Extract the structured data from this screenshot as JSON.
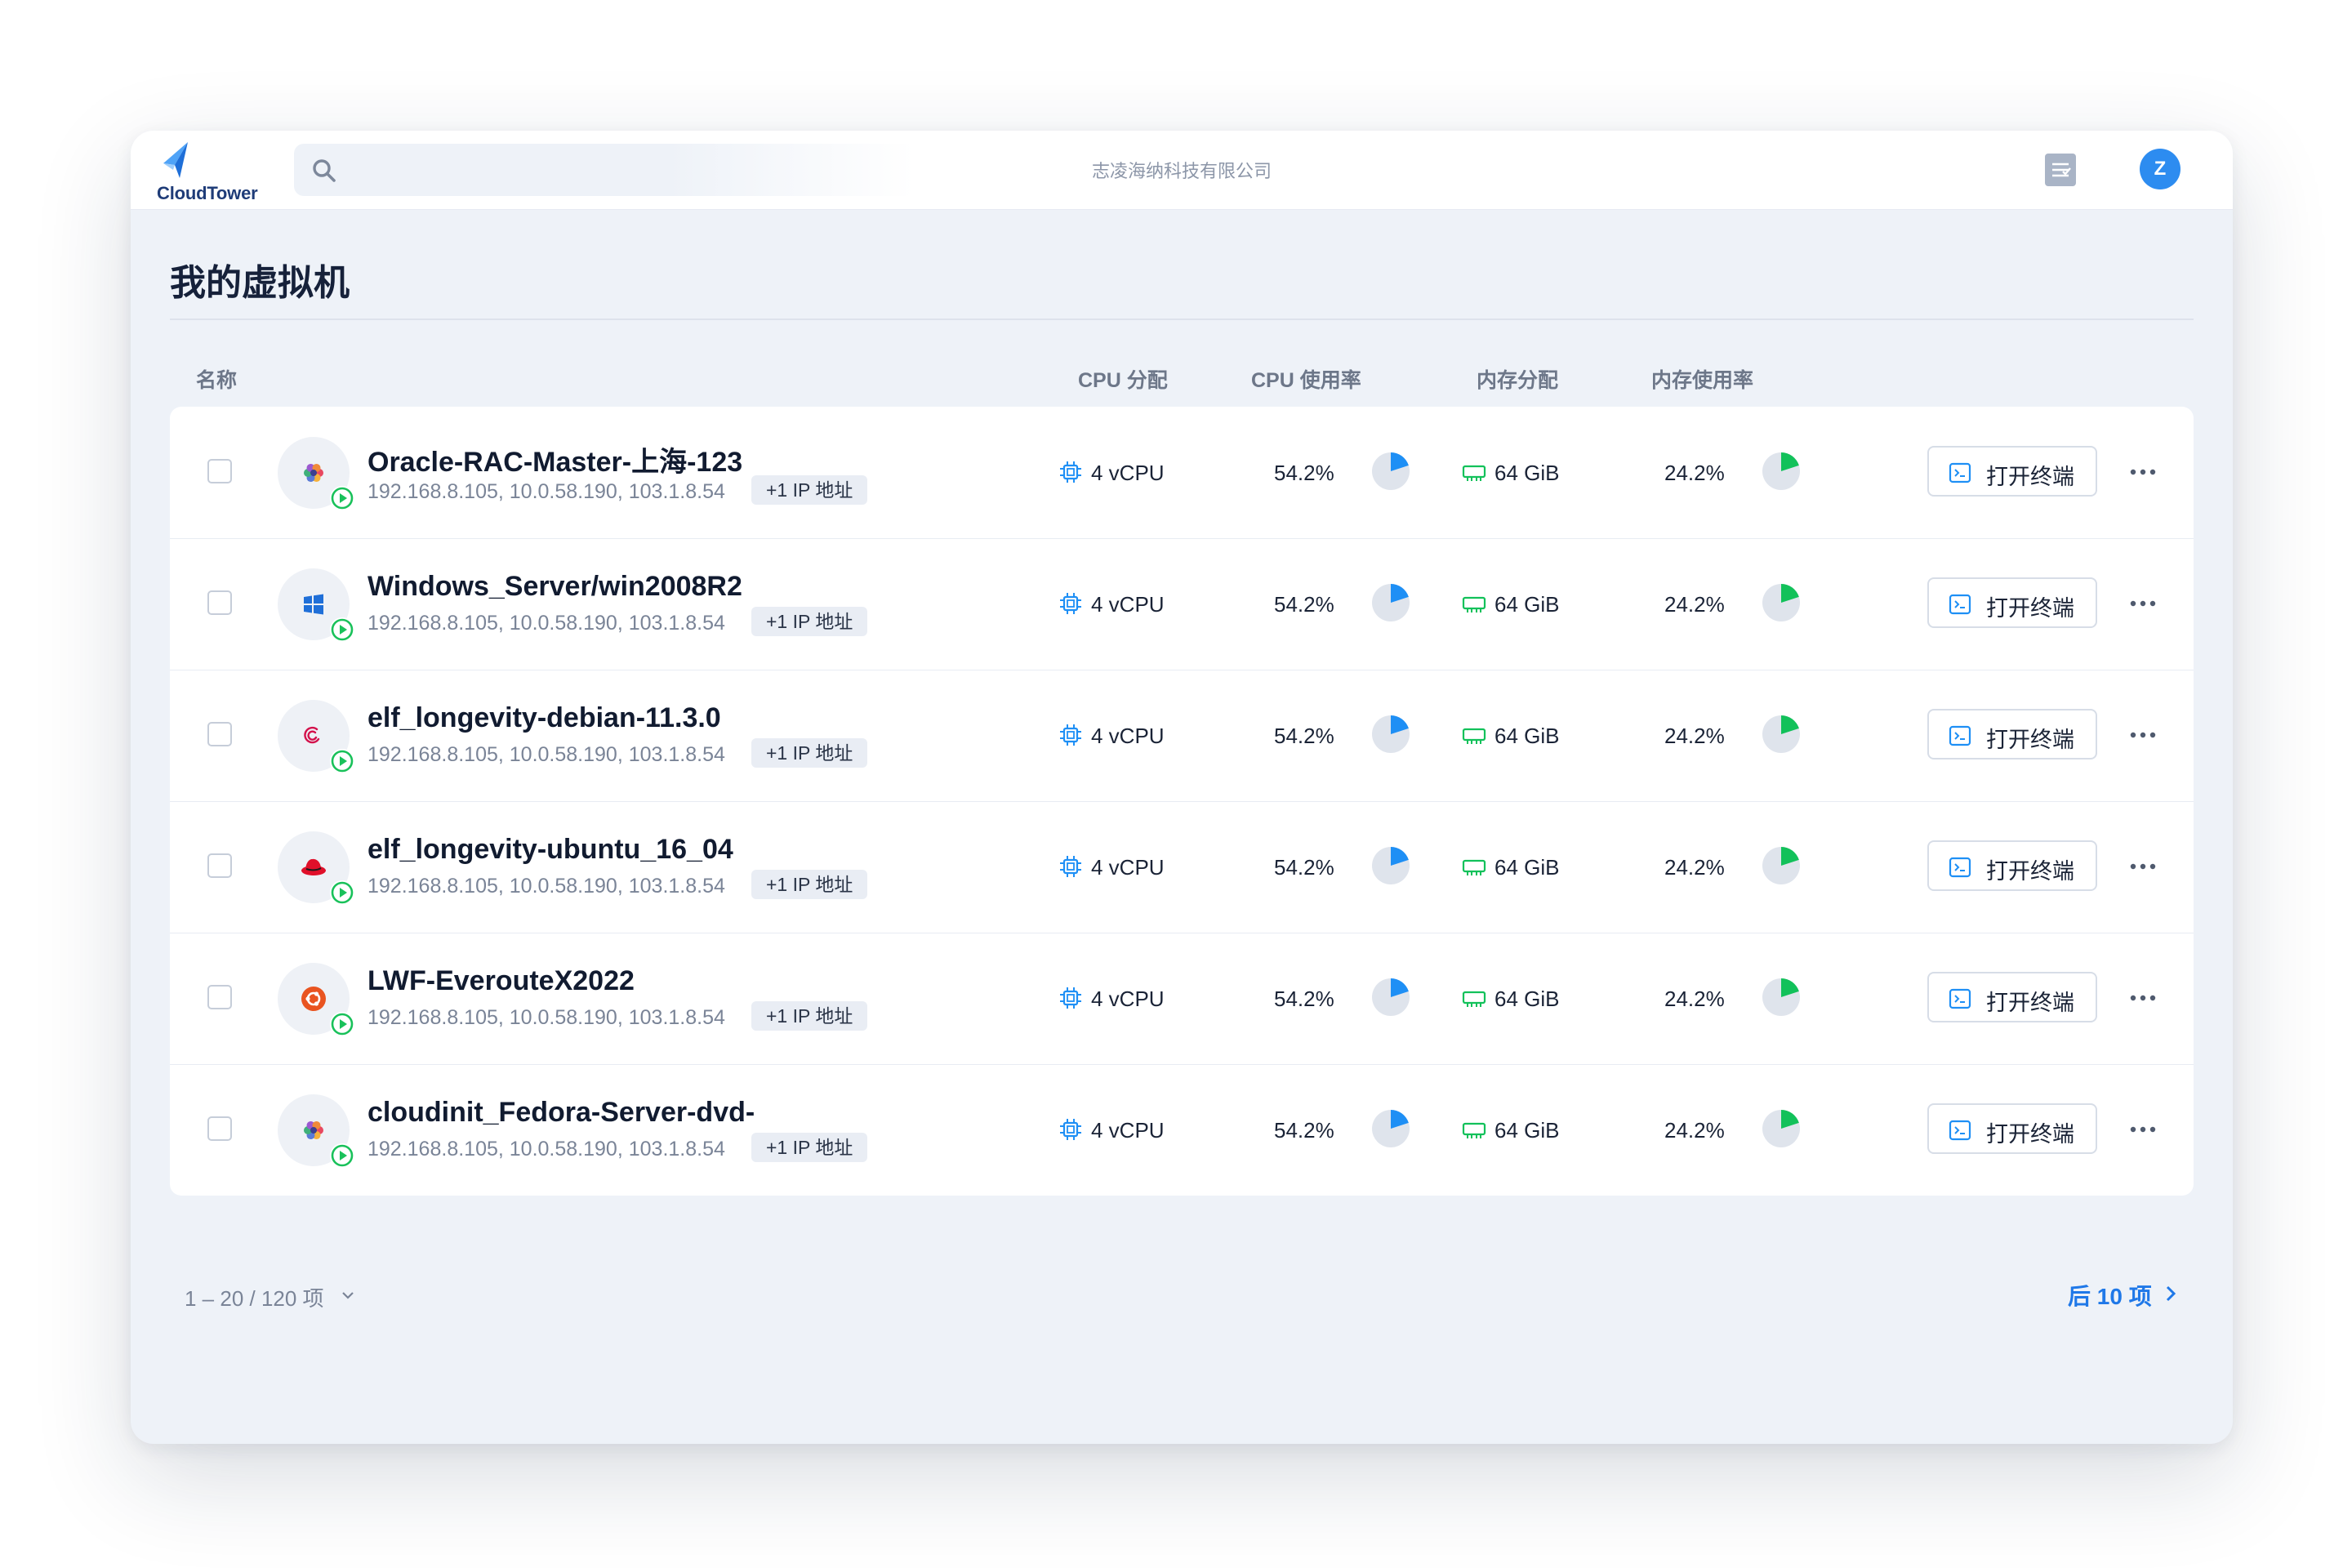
{
  "header": {
    "logo_text": "CloudTower",
    "company": "志凌海纳科技有限公司",
    "avatar_letter": "Z"
  },
  "page": {
    "title": "我的虚拟机"
  },
  "columns": {
    "name": "名称",
    "cpu_alloc": "CPU 分配",
    "cpu_usage": "CPU 使用率",
    "mem_alloc": "内存分配",
    "mem_usage": "内存使用率"
  },
  "colors": {
    "accent": "#1f78e8",
    "cpu_pie": "#1e8ff5",
    "mem_pie": "#12c15a",
    "pie_track": "#dfe4ec",
    "running": "#19c15a"
  },
  "vms": [
    {
      "name": "Oracle-RAC-Master-上海-123",
      "os_icon": "fedora-icon",
      "status": "running",
      "ips": "192.168.8.105, 10.0.58.190, 103.1.8.54",
      "extra_ips": "+1 IP 地址",
      "cpu_alloc": "4 vCPU",
      "cpu_usage": "54.2%",
      "cpu_fraction": 0.2,
      "mem_alloc": "64 GiB",
      "mem_usage": "24.2%",
      "mem_fraction": 0.2,
      "terminal_label": "打开终端"
    },
    {
      "name": "Windows_Server/win2008R2",
      "os_icon": "windows-icon",
      "status": "running",
      "ips": "192.168.8.105, 10.0.58.190, 103.1.8.54",
      "extra_ips": "+1 IP 地址",
      "cpu_alloc": "4 vCPU",
      "cpu_usage": "54.2%",
      "cpu_fraction": 0.2,
      "mem_alloc": "64 GiB",
      "mem_usage": "24.2%",
      "mem_fraction": 0.2,
      "terminal_label": "打开终端"
    },
    {
      "name": "elf_longevity-debian-11.3.0",
      "os_icon": "debian-icon",
      "status": "running",
      "ips": "192.168.8.105, 10.0.58.190, 103.1.8.54",
      "extra_ips": "+1 IP 地址",
      "cpu_alloc": "4 vCPU",
      "cpu_usage": "54.2%",
      "cpu_fraction": 0.2,
      "mem_alloc": "64 GiB",
      "mem_usage": "24.2%",
      "mem_fraction": 0.2,
      "terminal_label": "打开终端"
    },
    {
      "name": "elf_longevity-ubuntu_16_04",
      "os_icon": "redhat-icon",
      "status": "running",
      "ips": "192.168.8.105, 10.0.58.190, 103.1.8.54",
      "extra_ips": "+1 IP 地址",
      "cpu_alloc": "4 vCPU",
      "cpu_usage": "54.2%",
      "cpu_fraction": 0.2,
      "mem_alloc": "64 GiB",
      "mem_usage": "24.2%",
      "mem_fraction": 0.2,
      "terminal_label": "打开终端"
    },
    {
      "name": "LWF-EverouteX2022",
      "os_icon": "ubuntu-icon",
      "status": "running",
      "ips": "192.168.8.105, 10.0.58.190, 103.1.8.54",
      "extra_ips": "+1 IP 地址",
      "cpu_alloc": "4 vCPU",
      "cpu_usage": "54.2%",
      "cpu_fraction": 0.2,
      "mem_alloc": "64 GiB",
      "mem_usage": "24.2%",
      "mem_fraction": 0.2,
      "terminal_label": "打开终端"
    },
    {
      "name": "cloudinit_Fedora-Server-dvd-",
      "os_icon": "fedora-icon",
      "status": "running",
      "ips": "192.168.8.105, 10.0.58.190, 103.1.8.54",
      "extra_ips": "+1 IP 地址",
      "cpu_alloc": "4 vCPU",
      "cpu_usage": "54.2%",
      "cpu_fraction": 0.2,
      "mem_alloc": "64 GiB",
      "mem_usage": "24.2%",
      "mem_fraction": 0.2,
      "terminal_label": "打开终端"
    }
  ],
  "footer": {
    "range": "1 – 20 / 120 项",
    "next_label": "后 10 项"
  }
}
